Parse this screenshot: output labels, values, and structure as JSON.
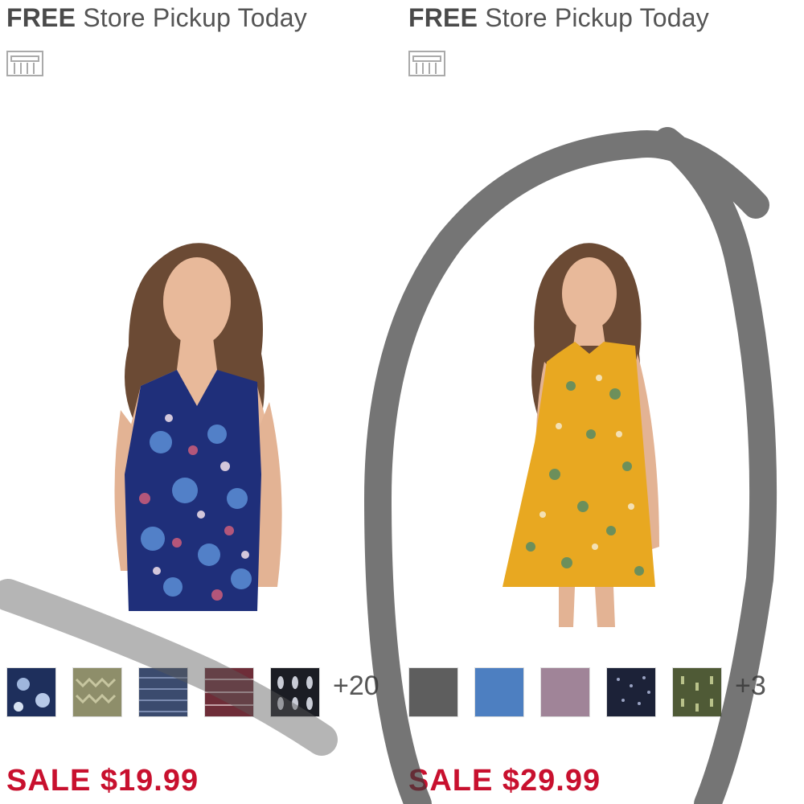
{
  "products": [
    {
      "pickup_free": "FREE",
      "pickup_rest": "Store Pickup Today",
      "store_icon": "store-building-icon",
      "image_alt": "Woman wearing blue floral sleeveless top",
      "swatches": [
        "navy-floral",
        "olive-pattern",
        "blue-stripe",
        "burgundy-stripe",
        "black-white-pattern"
      ],
      "more_colors": "+20",
      "price": "SALE $19.99"
    },
    {
      "pickup_free": "FREE",
      "pickup_rest": "Store Pickup Today",
      "store_icon": "store-building-icon",
      "image_alt": "Woman wearing yellow floral sleeveless dress",
      "swatches": [
        "gray",
        "chambray-blue",
        "mauve",
        "navy-dot",
        "olive-dot"
      ],
      "more_colors": "+3",
      "price": "SALE $29.99"
    }
  ],
  "colors": {
    "sale_red": "#c8102e",
    "text_gray": "#555555",
    "annotation_stroke": "#3a3a3a"
  }
}
